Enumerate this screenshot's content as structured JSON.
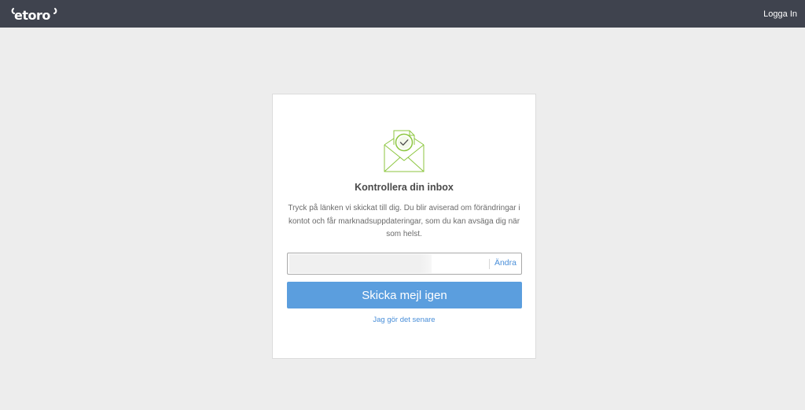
{
  "header": {
    "logo_text": "etoro",
    "login_label": "Logga In",
    "bg_color": "#3f434e"
  },
  "card": {
    "icon": "envelope-check-icon",
    "title": "Kontrollera din inbox",
    "description": "Tryck på länken vi skickat till dig. Du blir aviserad om förändringar i kontot och får marknadsuppdateringar, som du kan avsäga dig när som helst.",
    "email": {
      "value": "",
      "change_label": "Ändra"
    },
    "resend_label": "Skicka mejl igen",
    "later_label": "Jag gör det senare"
  },
  "colors": {
    "accent": "#5b9ede",
    "link": "#4a8fd9",
    "icon_green": "#8cc63f"
  }
}
